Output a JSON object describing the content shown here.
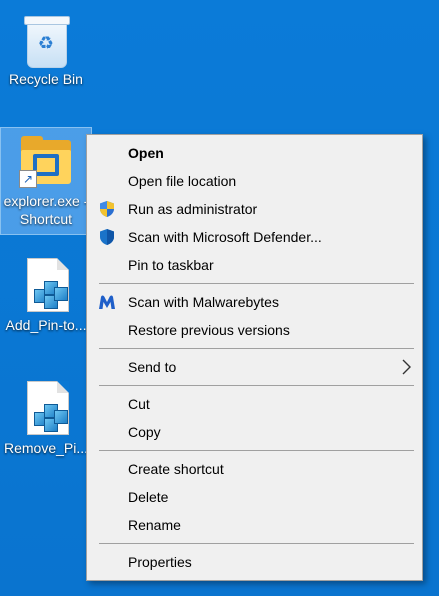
{
  "desktop": {
    "icons": [
      {
        "label": "Recycle Bin",
        "icon": "recycle-bin-icon"
      },
      {
        "label": "explorer.exe - Shortcut",
        "icon": "folder-shortcut-icon",
        "selected": true
      },
      {
        "label": "Add_Pin-to...",
        "icon": "registry-file-icon"
      },
      {
        "label": "Remove_Pi...",
        "icon": "registry-file-icon"
      }
    ]
  },
  "context_menu": {
    "items": [
      {
        "label": "Open",
        "bold": true
      },
      {
        "label": "Open file location"
      },
      {
        "label": "Run as administrator",
        "icon": "uac-shield-icon"
      },
      {
        "label": "Scan with Microsoft Defender...",
        "icon": "defender-shield-icon"
      },
      {
        "label": "Pin to taskbar"
      },
      {
        "label": "Scan with Malwarebytes",
        "icon": "malwarebytes-icon"
      },
      {
        "label": "Restore previous versions"
      },
      {
        "label": "Send to",
        "submenu": true
      },
      {
        "label": "Cut"
      },
      {
        "label": "Copy"
      },
      {
        "label": "Create shortcut"
      },
      {
        "label": "Delete"
      },
      {
        "label": "Rename"
      },
      {
        "label": "Properties"
      }
    ]
  },
  "colors": {
    "desktop_bg": "#0a78d4",
    "menu_bg": "#f0f0f0",
    "menu_border": "#a0a0a0",
    "defender_blue": "#1a73c9",
    "malwarebytes_blue": "#1f5fc9"
  }
}
